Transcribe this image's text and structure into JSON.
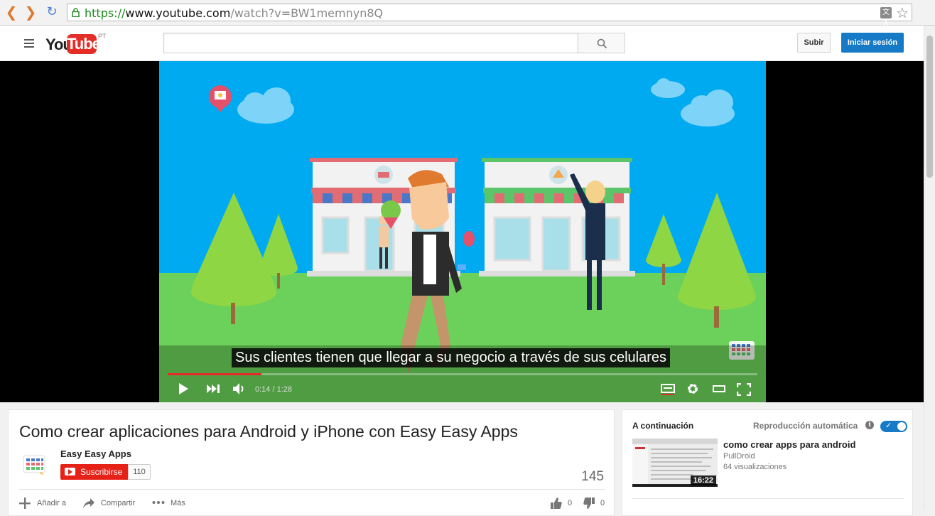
{
  "browser": {
    "url_scheme": "https://",
    "url_host": "www.youtube.com",
    "url_path": "/watch?v=BW1memnyn8Q",
    "translate_glyph": "文A"
  },
  "masthead": {
    "logo_you": "You",
    "logo_tube": "Tube",
    "region": "PT",
    "search_value": "",
    "upload_label": "Subir",
    "signin_label": "Iniciar sesión"
  },
  "player": {
    "caption": "Sus clientes tienen que llegar a su negocio a través de sus celulares",
    "time": "0:14 / 1:28",
    "progress_fraction": 0.159
  },
  "video_info": {
    "title": "Como crear aplicaciones para Android y iPhone con Easy Easy Apps",
    "channel": "Easy Easy Apps",
    "subscribe_label": "Suscribirse",
    "subscriber_count": "110",
    "views": "145",
    "add_to_label": "Añadir a",
    "share_label": "Compartir",
    "more_label": "Más",
    "likes": "0",
    "dislikes": "0"
  },
  "sidebar": {
    "up_next_label": "A continuación",
    "autoplay_label": "Reproducción automática",
    "info_glyph": "i",
    "autoplay_on": true,
    "next_video": {
      "title": "como crear apps para android",
      "channel": "PullDroid",
      "views": "64 visualizaciones",
      "duration": "16:22"
    }
  },
  "colors": {
    "brand_red": "#e52d27",
    "accent_blue": "#167ac6",
    "sky": "#00aaf0",
    "grass": "#6bd15a"
  }
}
